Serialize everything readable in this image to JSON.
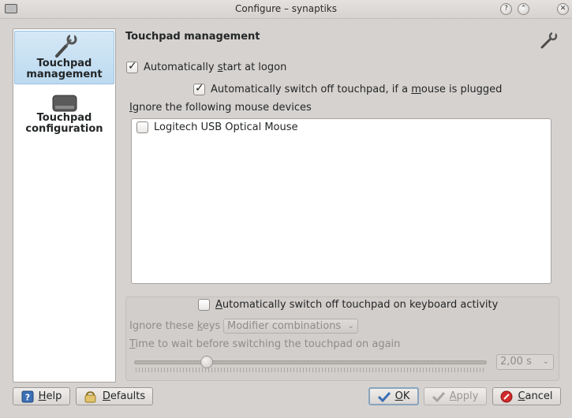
{
  "window": {
    "title": "Configure – synaptiks"
  },
  "sidebar": {
    "items": [
      {
        "label_line1": "Touchpad",
        "label_line2": "management",
        "icon": "wrench-icon"
      },
      {
        "label_line1": "Touchpad",
        "label_line2": "configuration",
        "icon": "touchpad-icon"
      }
    ]
  },
  "main": {
    "title": "Touchpad management",
    "auto_start": {
      "pre": "Automatically ",
      "u": "s",
      "post": "tart at logon",
      "checked": true
    },
    "auto_switch_mouse": {
      "pre": "Automatically switch off touchpad, if a ",
      "u": "m",
      "post": "ouse is plugged",
      "checked": true
    },
    "ignore_label": {
      "u": "I",
      "post": "gnore the following mouse devices"
    },
    "devices": [
      {
        "label": "Logitech USB Optical Mouse",
        "checked": false
      }
    ],
    "keyboard_group": {
      "auto_switch_kbd": {
        "u": "A",
        "post": "utomatically switch off touchpad on keyboard activity",
        "checked": false
      },
      "ignore_keys_label": {
        "pre": "Ignore these ",
        "u": "k",
        "post": "eys"
      },
      "ignore_keys_value": "Modifier combinations",
      "wait_label": {
        "u": "T",
        "post": "ime to wait before switching the touchpad on again"
      },
      "wait_value": "2,00 s",
      "wait_slider_level": 0.2
    }
  },
  "buttons": {
    "help": {
      "u": "H",
      "post": "elp"
    },
    "defaults": {
      "u": "D",
      "post": "efaults"
    },
    "ok": {
      "u": "O",
      "post": "K"
    },
    "apply": {
      "u": "A",
      "post": "pply"
    },
    "cancel": {
      "u": "C",
      "post": "ancel"
    }
  }
}
